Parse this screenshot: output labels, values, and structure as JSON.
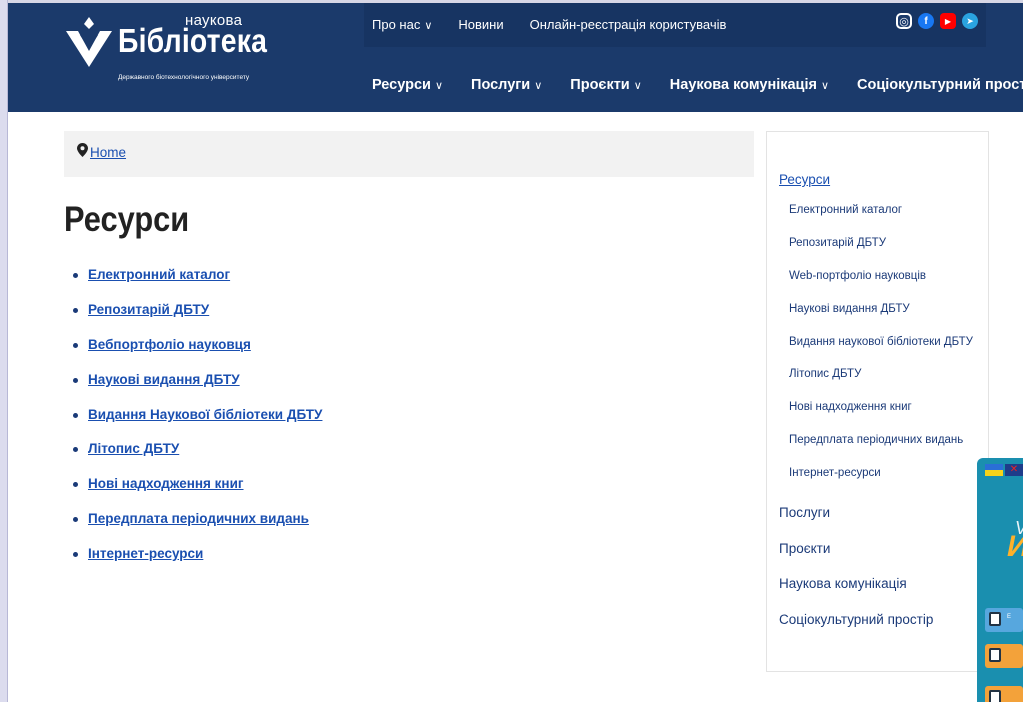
{
  "logo": {
    "top_word": "наукова",
    "main_word": "Бібліотека",
    "subtitle": "Державного біотехнологічного університету"
  },
  "top_nav": [
    {
      "label": "Про нас",
      "dropdown": true
    },
    {
      "label": "Новини",
      "dropdown": false
    },
    {
      "label": "Онлайн-реєстрація користувачів",
      "dropdown": false
    }
  ],
  "social": [
    {
      "icon": "instagram-icon",
      "color": "#1b3a6b",
      "glyph": "◎"
    },
    {
      "icon": "facebook-icon",
      "color": "#1877f2",
      "glyph": "f"
    },
    {
      "icon": "youtube-icon",
      "color": "#ff0000",
      "glyph": "▶"
    },
    {
      "icon": "telegram-icon",
      "color": "#2aa3e0",
      "glyph": "➤"
    }
  ],
  "main_nav": [
    {
      "label": "Ресурси"
    },
    {
      "label": "Послуги"
    },
    {
      "label": "Проєкти"
    },
    {
      "label": "Наукова комунікація"
    },
    {
      "label": "Соціокультурний простір"
    }
  ],
  "breadcrumb": {
    "home": "Home"
  },
  "page_title": "Ресурси",
  "resources": [
    "Електронний каталог",
    "Репозитарій ДБТУ",
    "Вебпортфоліо науковця",
    "Наукові видання ДБТУ",
    "Видання Наукової бібліотеки ДБТУ",
    "Літопис ДБТУ",
    "Нові надходження книг",
    "Передплата періодичних видань",
    "Інтернет-ресурси"
  ],
  "sidebar": {
    "heading": "Ресурси",
    "sub_items": [
      "Електронний каталог",
      "Репозитарій ДБТУ",
      "Web-портфоліо науковців",
      "Наукові видання ДБТУ",
      "Видання наукової бібліотеки ДБТУ",
      "Літопис ДБТУ",
      "Нові надходження книг",
      "Передплата періодичних видань",
      "Інтернет-ресурси"
    ],
    "main_items": [
      "Послуги",
      "Проєкти",
      "Наукова комунікація",
      "Соціокультурний простір"
    ]
  },
  "widget": {
    "text1": "V",
    "text2": "И",
    "row1_text": "Е",
    "colors": {
      "panel": "#1a8faf",
      "accent": "#ffb12a"
    }
  },
  "colors": {
    "header": "#1b3a6b",
    "link": "#1a4fb0",
    "sidebar_text": "#1b3a78"
  }
}
